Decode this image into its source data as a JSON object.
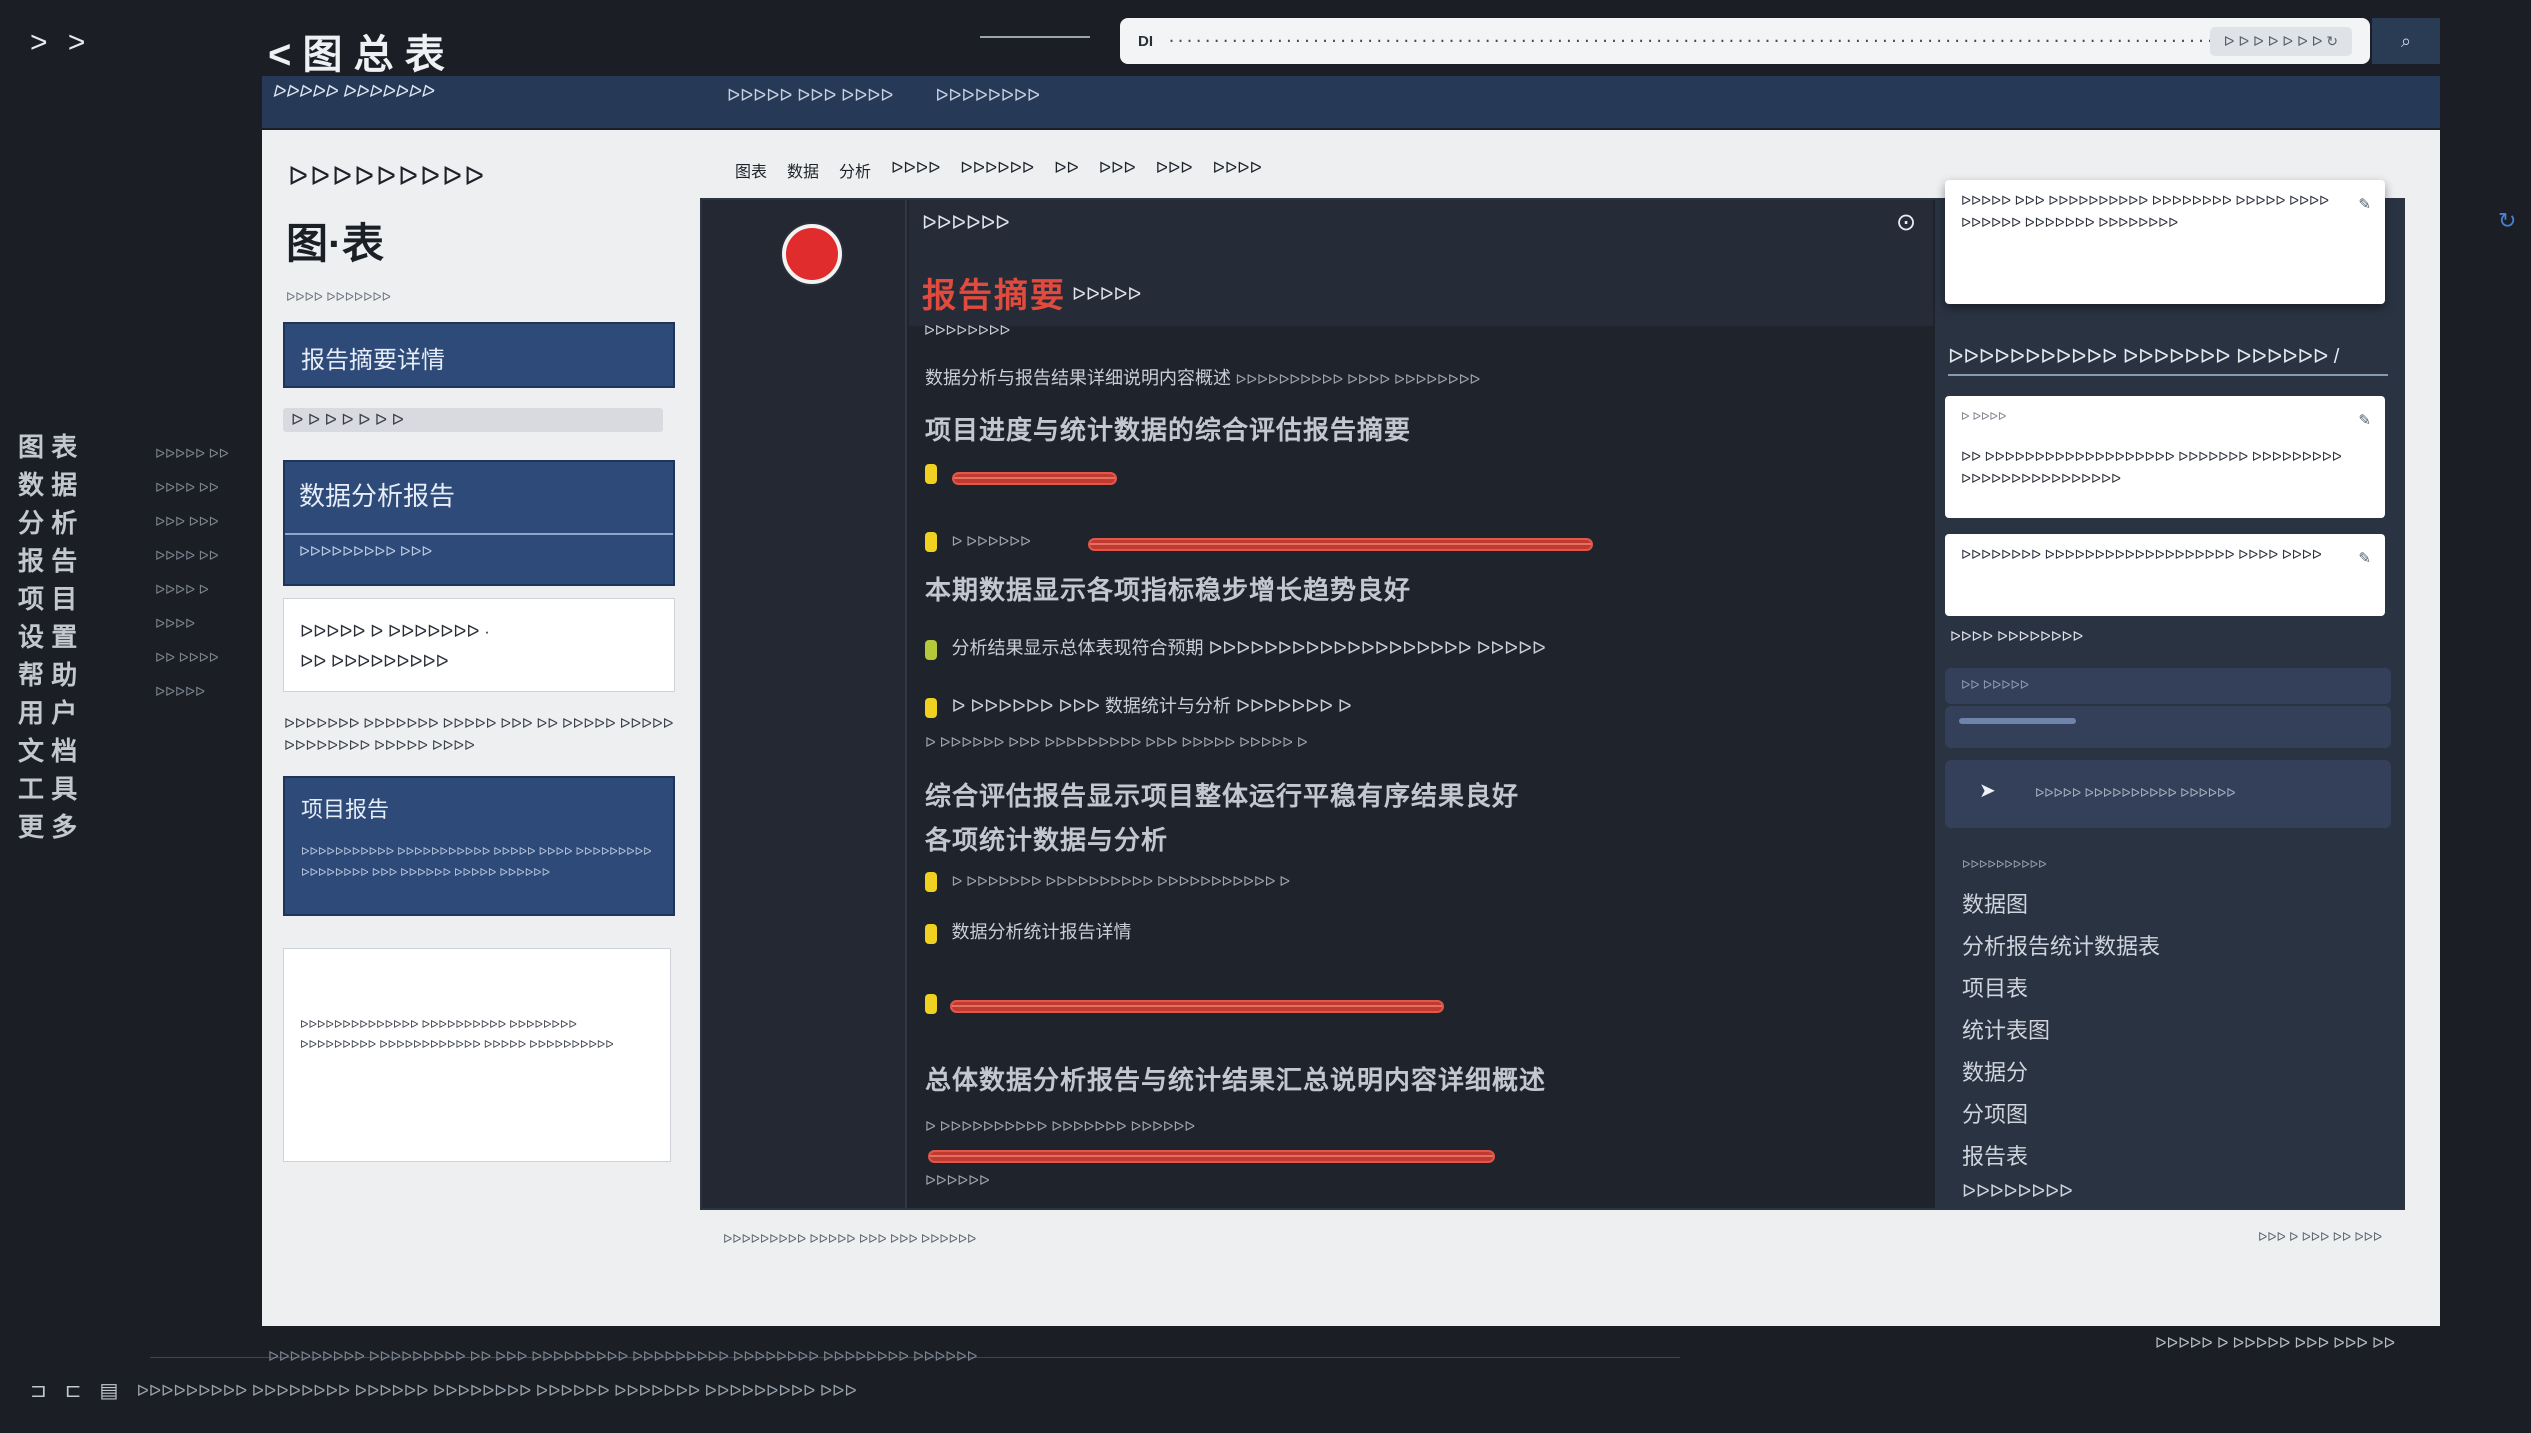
{
  "chrome": {
    "forward_label": "> >",
    "back_label": "< 图 总 表",
    "address_prefix": "DI",
    "address_url": "··································································································································",
    "address_right": "ᐅ ᐅ ᐅ ᐅ ᐅ ᐅ ᐅ ↻",
    "address_button": "⌕"
  },
  "navstrip": {
    "brand": "ᐅᐅᐅᐅᐅ ᐅᐅᐅᐅᐅᐅᐅ",
    "links": [
      "ᐅᐅᐅᐅᐅ  ᐅᐅᐅ ᐅᐅᐅᐅ",
      "ᐅᐅᐅᐅᐅᐅᐅᐅ"
    ]
  },
  "leftlist": {
    "items": [
      "图 表",
      "数 据",
      "分 析",
      "报 告",
      "项 目",
      "设 置",
      "帮 助",
      "用 户",
      "文 档",
      "工 具",
      "更 多"
    ],
    "sub_items": [
      "ᐅᐅᐅᐅᐅ ᐅᐅ",
      "ᐅᐅᐅᐅ ᐅᐅ",
      "ᐅᐅᐅ ᐅᐅᐅ",
      "ᐅᐅᐅᐅ ᐅᐅ",
      "ᐅᐅᐅᐅ ᐅ",
      "ᐅᐅᐅᐅ",
      "ᐅᐅ ᐅᐅᐅᐅ",
      "ᐅᐅᐅᐅᐅ"
    ]
  },
  "sidebar": {
    "title": "ᐅᐅᐅᐅᐅᐅᐅᐅᐅ",
    "subtitle": "图·表",
    "small": "ᐅᐅᐅᐅ ᐅᐅᐅᐅᐅᐅᐅ",
    "card1": "报告摘要详情",
    "pill": "ᐅ ᐅ ᐅ ᐅ ᐅ ᐅ ᐅ",
    "card2_title": "数据分析报告",
    "card2_sub": "ᐅᐅᐅᐅᐅᐅᐅᐅᐅ ᐅᐅᐅ",
    "white1_line1": "ᐅᐅᐅᐅᐅ ᐅ ᐅᐅᐅᐅᐅᐅᐅ ·",
    "white1_line2": "ᐅᐅ   ᐅᐅᐅᐅᐅᐅᐅᐅᐅ",
    "text_block": "ᐅᐅᐅᐅᐅᐅᐅ ᐅᐅᐅᐅᐅᐅᐅ ᐅᐅᐅᐅᐅ ᐅᐅᐅ ᐅᐅ ᐅᐅᐅᐅᐅ ᐅᐅᐅᐅᐅ ᐅᐅᐅᐅᐅᐅᐅᐅ ᐅᐅᐅᐅᐅ ᐅᐅᐅᐅ",
    "card3_title": "项目报告",
    "card3_body": "ᐅᐅᐅᐅᐅᐅᐅᐅᐅᐅᐅ ᐅᐅᐅᐅᐅᐅᐅᐅᐅᐅᐅ ᐅᐅᐅᐅᐅ ᐅᐅᐅᐅ ᐅᐅᐅᐅᐅᐅᐅᐅᐅ ᐅᐅᐅᐅᐅᐅᐅᐅ ᐅᐅᐅ ᐅᐅᐅᐅᐅᐅ ᐅᐅᐅᐅᐅ ᐅᐅᐅᐅᐅᐅ",
    "white2_body": "ᐅᐅᐅᐅᐅᐅᐅᐅᐅᐅᐅᐅᐅᐅ ᐅᐅᐅᐅᐅᐅᐅᐅᐅᐅ ᐅᐅᐅᐅᐅᐅᐅᐅ ᐅᐅᐅᐅᐅᐅᐅᐅᐅ ᐅᐅᐅᐅᐅᐅᐅᐅᐅᐅᐅᐅ ᐅᐅᐅᐅᐅ ᐅᐅᐅᐅᐅᐅᐅᐅᐅᐅ"
  },
  "tabs": [
    "图表",
    "数据",
    "分析",
    "ᐅᐅᐅᐅ",
    "ᐅᐅᐅᐅᐅᐅ",
    "ᐅᐅ",
    "ᐅᐅᐅ",
    "ᐅᐅᐅ",
    "ᐅᐅᐅᐅ"
  ],
  "panel": {
    "header_label": "ᐅᐅᐅᐅᐅᐅ",
    "header_red": "报告摘要",
    "header_sub": "ᐅᐅᐅᐅᐅ",
    "header_small": "ᐅᐅᐅᐅᐅᐅᐅᐅ",
    "rows": [
      {
        "big": "数据分析与报告结果详细说明内容概述",
        "small": "ᐅᐅᐅᐅᐅᐅᐅᐅᐅᐅ ᐅᐅᐅᐅ ᐅᐅᐅᐅᐅᐅᐅᐅ"
      },
      {
        "big": "项目进度与统计数据的综合评估报告摘要",
        "small": "ᐅᐅ"
      },
      {
        "label": "ᐅ ᐅᐅᐅᐅᐅᐅ"
      },
      {
        "big": "本期数据显示各项指标稳步增长趋势良好",
        "small": ""
      },
      {
        "med": "分析结果显示总体表现符合预期 ᐅᐅᐅᐅᐅᐅᐅᐅᐅᐅᐅᐅᐅᐅᐅᐅᐅᐅᐅ ᐅᐅᐅᐅᐅ"
      },
      {
        "med": "ᐅ ᐅᐅᐅᐅᐅᐅ ᐅᐅᐅ 数据统计与分析 ᐅᐅᐅᐅᐅᐅᐅ ᐅ"
      },
      {
        "sm": "ᐅ ᐅᐅᐅᐅᐅᐅ ᐅᐅᐅ ᐅᐅᐅᐅᐅᐅᐅᐅᐅ ᐅᐅᐅ ᐅᐅᐅᐅᐅ ᐅᐅᐅᐅᐅ ᐅ"
      },
      {
        "big": "综合评估报告显示项目整体运行平稳有序结果良好",
        "small": "ᐅᐅᐅᐅᐅᐅᐅᐅᐅᐅ ᐅᐅᐅᐅᐅᐅᐅᐅᐅ"
      },
      {
        "big": "各项统计数据与分析",
        "small": ""
      },
      {
        "sm": "ᐅ ᐅᐅᐅᐅᐅᐅᐅ ᐅᐅᐅᐅᐅᐅᐅᐅᐅᐅ ᐅᐅᐅᐅᐅᐅᐅᐅᐅᐅᐅ ᐅ"
      },
      {
        "med": "数据分析统计报告详情"
      },
      {
        "big": "总体数据分析报告与统计结果汇总说明内容详细概述",
        "small": ""
      },
      {
        "sm": "ᐅ ᐅᐅᐅᐅᐅᐅᐅᐅᐅᐅ ᐅᐅᐅᐅᐅᐅᐅ ᐅᐅᐅᐅᐅᐅ"
      },
      {
        "sm": "ᐅᐅᐅᐅᐅᐅ"
      }
    ],
    "bars": [
      0.16,
      0.49,
      0.48,
      0.55
    ],
    "bar_color": "#c2392f"
  },
  "right": {
    "card_top": "ᐅᐅᐅᐅᐅ ᐅᐅᐅ ᐅᐅᐅᐅᐅᐅᐅᐅᐅᐅ ᐅᐅᐅᐅᐅᐅᐅᐅ ᐅᐅᐅᐅᐅ ᐅᐅᐅᐅ ᐅᐅᐅᐅᐅᐅ ᐅᐅᐅᐅᐅᐅᐅ ᐅᐅᐅᐅᐅᐅᐅᐅ",
    "head": "ᐅᐅᐅᐅᐅᐅᐅᐅᐅᐅᐅ ᐅᐅᐅᐅᐅᐅᐅ ᐅᐅᐅᐅᐅᐅ /",
    "card2_top": "ᐅ ᐅᐅᐅᐅ",
    "card2_body": "ᐅᐅ ᐅᐅᐅᐅᐅᐅᐅᐅᐅᐅᐅᐅᐅᐅᐅᐅᐅᐅᐅ ᐅᐅᐅᐅᐅᐅᐅ ᐅᐅᐅᐅᐅᐅᐅᐅᐅ ᐅᐅᐅᐅᐅᐅᐅᐅᐅᐅᐅᐅᐅᐅᐅᐅ",
    "card3_body": "ᐅᐅᐅᐅᐅᐅᐅᐅ ᐅᐅᐅᐅᐅᐅᐅᐅᐅᐅᐅᐅᐅᐅᐅᐅᐅᐅᐅ ᐅᐅᐅᐅ ᐅᐅᐅᐅ",
    "label": "ᐅᐅᐅᐅ ᐅᐅᐅᐅᐅᐅᐅᐅ",
    "bar1": "ᐅᐅ ᐅᐅᐅᐅᐅ",
    "bar2_fill": 0.28,
    "bar3_text": "ᐅᐅᐅᐅᐅ ᐅᐅᐅᐅᐅᐅᐅᐅᐅᐅ ᐅᐅᐅᐅᐅᐅ",
    "list_head": "ᐅᐅᐅᐅᐅᐅᐅᐅᐅᐅ",
    "list": [
      "数据图",
      "分析报告统计数据表",
      "项目表",
      "统计表图",
      "数据分",
      "分项图",
      "报告表"
    ],
    "list_last": "ᐅᐅᐅᐅᐅᐅᐅᐅ"
  },
  "footer": {
    "frame_left": "ᐅᐅᐅᐅᐅᐅᐅᐅᐅ ᐅᐅᐅᐅᐅ ᐅᐅᐅ ᐅᐅᐅ ᐅᐅᐅᐅᐅᐅ",
    "frame_right": "ᐅᐅᐅ ᐅ ᐅᐅᐅ ᐅᐅ ᐅᐅᐅ",
    "status": "ᐅᐅᐅᐅᐅᐅᐅᐅᐅ ᐅᐅᐅᐅᐅᐅᐅᐅᐅ ᐅᐅ ᐅᐅᐅ ᐅᐅᐅᐅᐅᐅᐅᐅᐅ ᐅᐅᐅᐅᐅᐅᐅᐅᐅ ᐅᐅᐅᐅᐅᐅᐅᐅ ᐅᐅᐅᐅᐅᐅᐅᐅ ᐅᐅᐅᐅᐅᐅ",
    "status_right": "ᐅᐅᐅᐅᐅ ᐅ ᐅᐅᐅᐅᐅ  ᐅᐅᐅ ᐅᐅᐅ ᐅᐅ",
    "taskbar": "ᐅᐅᐅᐅᐅᐅᐅᐅᐅ ᐅᐅᐅᐅᐅᐅᐅᐅ ᐅᐅᐅᐅᐅᐅ ᐅᐅᐅᐅᐅᐅᐅᐅ ᐅᐅᐅᐅᐅᐅ ᐅᐅᐅᐅᐅᐅᐅ ᐅᐅᐅᐅᐅᐅᐅᐅᐅ ᐅᐅᐅ"
  }
}
